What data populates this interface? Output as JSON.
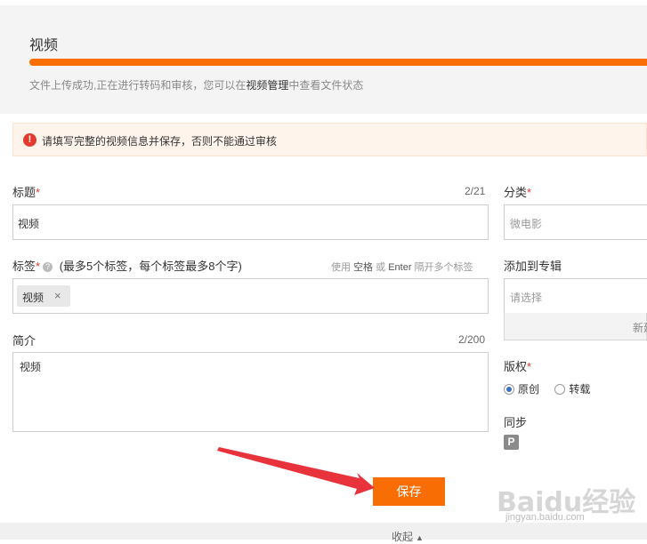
{
  "upload": {
    "title": "视频",
    "progress_percent": 100,
    "msg_before": "文件上传成功,正在进行转码和审核，您可以在",
    "msg_link": "视频管理",
    "msg_after": "中查看文件状态"
  },
  "warning": {
    "icon": "!",
    "text": "请填写完整的视频信息并保存，否则不能通过审核"
  },
  "form": {
    "title": {
      "label": "标题",
      "required": "*",
      "counter": "2/21",
      "value": "视频"
    },
    "tags": {
      "label": "标签",
      "required": "*",
      "help": "?",
      "note": "(最多5个标签，每个标签最多8个字)",
      "hint_prefix": "使用",
      "hint_key1": "空格",
      "hint_or": "或",
      "hint_key2": "Enter",
      "hint_suffix": "隔开多个标签",
      "items": [
        {
          "label": "视频",
          "close": "×"
        }
      ]
    },
    "intro": {
      "label": "简介",
      "counter": "2/200",
      "value": "视频"
    },
    "category": {
      "label": "分类",
      "required": "*",
      "placeholder": "微电影"
    },
    "album": {
      "label": "添加到专辑",
      "placeholder": "请选择",
      "new_label": "新建"
    },
    "copyright": {
      "label": "版权",
      "required": "*",
      "options": [
        {
          "label": "原创",
          "selected": true
        },
        {
          "label": "转载",
          "selected": false
        }
      ]
    },
    "sync": {
      "label": "同步",
      "icon": "P"
    }
  },
  "save_label": "保存",
  "collapse_label": "收起",
  "collapse_icon": "▲",
  "watermark": {
    "logo": "Baidu经验",
    "url": "jingyan.baidu.com"
  },
  "colors": {
    "accent": "#f86e04",
    "warning": "#e33a2f",
    "arrow": "#e8323c"
  }
}
